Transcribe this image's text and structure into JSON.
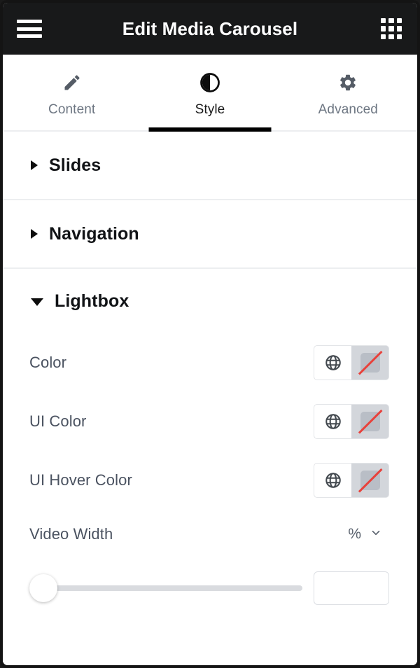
{
  "header": {
    "title": "Edit Media Carousel",
    "menu_icon": "hamburger-menu-icon",
    "grid_icon": "apps-grid-icon"
  },
  "tabs": [
    {
      "label": "Content",
      "icon": "pencil-icon",
      "active": false
    },
    {
      "label": "Style",
      "icon": "contrast-icon",
      "active": true
    },
    {
      "label": "Advanced",
      "icon": "gear-icon",
      "active": false
    }
  ],
  "sections": [
    {
      "title": "Slides",
      "expanded": false
    },
    {
      "title": "Navigation",
      "expanded": false
    },
    {
      "title": "Lightbox",
      "expanded": true
    }
  ],
  "lightbox": {
    "color": {
      "label": "Color",
      "globe_icon": "globe-icon",
      "swatch_state": "no-color",
      "slash_color": "#e8413b"
    },
    "ui_color": {
      "label": "UI Color",
      "globe_icon": "globe-icon",
      "swatch_state": "no-color"
    },
    "ui_hover_color": {
      "label": "UI Hover Color",
      "globe_icon": "globe-icon",
      "swatch_state": "no-color"
    },
    "video_width": {
      "label": "Video Width",
      "unit": "%",
      "unit_chevron_icon": "chevron-down-icon",
      "slider_value": 0,
      "input_value": "",
      "input_placeholder": ""
    }
  },
  "colors": {
    "header_bg": "#18191a",
    "accent": "#000000",
    "label_text": "#4a5260",
    "divider": "#eceef0"
  }
}
